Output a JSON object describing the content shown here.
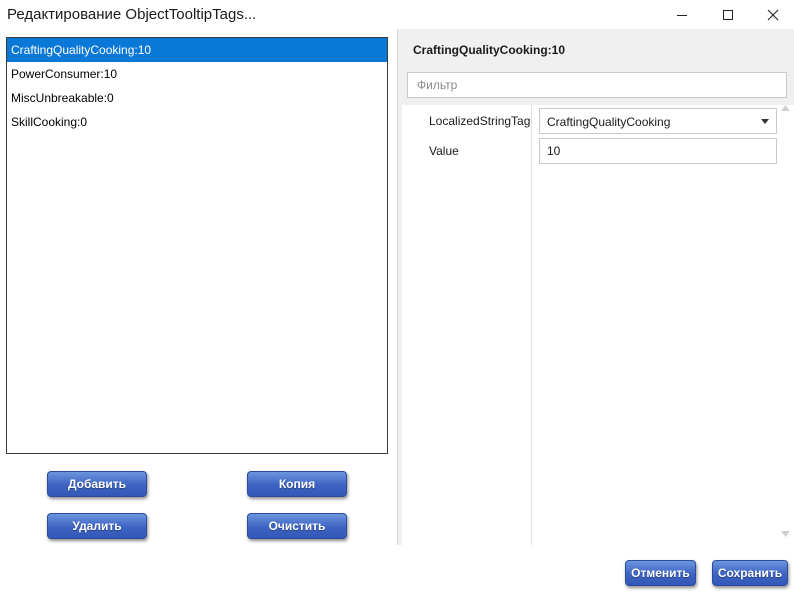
{
  "window": {
    "title": "Редактирование ObjectTooltipTags...",
    "controls": {
      "minimize_icon": "minimize-icon",
      "maximize_icon": "maximize-icon",
      "close_icon": "close-icon"
    }
  },
  "list": {
    "items": [
      {
        "label": "CraftingQualityCooking:10",
        "selected": true
      },
      {
        "label": "PowerConsumer:10",
        "selected": false
      },
      {
        "label": "MiscUnbreakable:0",
        "selected": false
      },
      {
        "label": "SkillCooking:0",
        "selected": false
      }
    ]
  },
  "list_buttons": {
    "add": "Добавить",
    "copy": "Копия",
    "delete": "Удалить",
    "clear": "Очистить"
  },
  "property_grid": {
    "title": "CraftingQualityCooking:10",
    "filter_placeholder": "Фильтр",
    "properties": [
      {
        "name": "LocalizedStringTag",
        "value": "CraftingQualityCooking",
        "editor": "combobox"
      },
      {
        "name": "Value",
        "value": "10",
        "editor": "textbox"
      }
    ]
  },
  "footer": {
    "cancel": "Отменить",
    "save": "Сохранить"
  },
  "colors": {
    "selection": "#0a78d7",
    "button_top": "#6c95dd",
    "button_bottom": "#3458b7",
    "panel_header": "#f0f0f0"
  }
}
